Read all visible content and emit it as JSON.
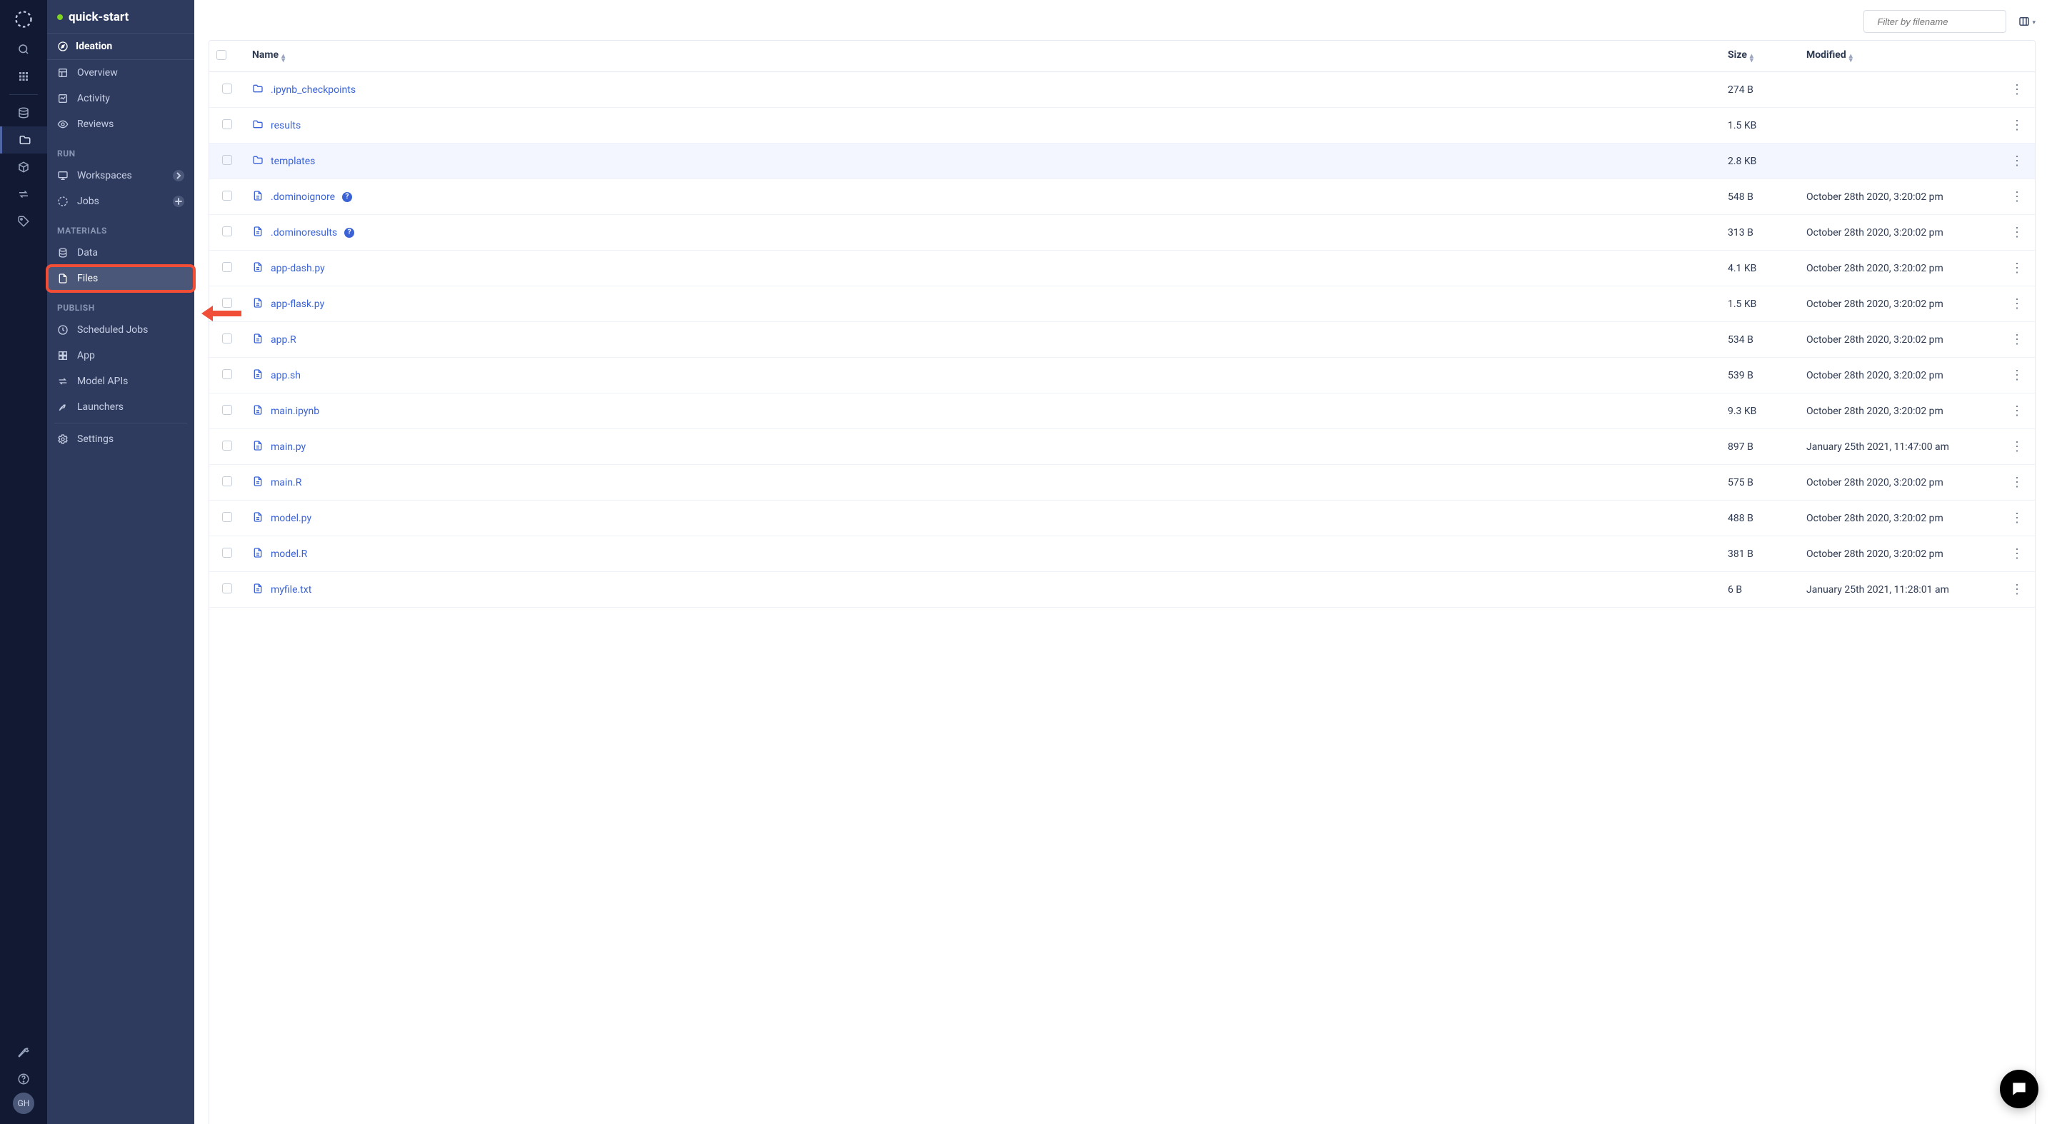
{
  "project": {
    "name": "quick-start"
  },
  "sidebar": {
    "section": "Ideation",
    "groups": {
      "ideation": [
        "Overview",
        "Activity",
        "Reviews"
      ],
      "run_label": "RUN",
      "run": [
        "Workspaces",
        "Jobs"
      ],
      "materials_label": "MATERIALS",
      "materials": [
        "Data",
        "Files"
      ],
      "publish_label": "PUBLISH",
      "publish": [
        "Scheduled Jobs",
        "App",
        "Model APIs",
        "Launchers"
      ]
    },
    "settings": "Settings"
  },
  "rail": {
    "avatar": "GH"
  },
  "topbar": {
    "search_placeholder": "Filter by filename"
  },
  "table": {
    "headers": {
      "name": "Name",
      "size": "Size",
      "modified": "Modified"
    },
    "rows": [
      {
        "type": "folder",
        "name": ".ipynb_checkpoints",
        "size": "274 B",
        "modified": "",
        "help": false
      },
      {
        "type": "folder",
        "name": "results",
        "size": "1.5 KB",
        "modified": "",
        "help": false
      },
      {
        "type": "folder",
        "name": "templates",
        "size": "2.8 KB",
        "modified": "",
        "help": false,
        "highlight": true
      },
      {
        "type": "file",
        "name": ".dominoignore",
        "size": "548 B",
        "modified": "October 28th 2020, 3:20:02 pm",
        "help": true
      },
      {
        "type": "file",
        "name": ".dominoresults",
        "size": "313 B",
        "modified": "October 28th 2020, 3:20:02 pm",
        "help": true
      },
      {
        "type": "file",
        "name": "app-dash.py",
        "size": "4.1 KB",
        "modified": "October 28th 2020, 3:20:02 pm",
        "help": false
      },
      {
        "type": "file",
        "name": "app-flask.py",
        "size": "1.5 KB",
        "modified": "October 28th 2020, 3:20:02 pm",
        "help": false
      },
      {
        "type": "file",
        "name": "app.R",
        "size": "534 B",
        "modified": "October 28th 2020, 3:20:02 pm",
        "help": false
      },
      {
        "type": "file",
        "name": "app.sh",
        "size": "539 B",
        "modified": "October 28th 2020, 3:20:02 pm",
        "help": false
      },
      {
        "type": "file",
        "name": "main.ipynb",
        "size": "9.3 KB",
        "modified": "October 28th 2020, 3:20:02 pm",
        "help": false
      },
      {
        "type": "file",
        "name": "main.py",
        "size": "897 B",
        "modified": "January 25th 2021, 11:47:00 am",
        "help": false
      },
      {
        "type": "file",
        "name": "main.R",
        "size": "575 B",
        "modified": "October 28th 2020, 3:20:02 pm",
        "help": false
      },
      {
        "type": "file",
        "name": "model.py",
        "size": "488 B",
        "modified": "October 28th 2020, 3:20:02 pm",
        "help": false
      },
      {
        "type": "file",
        "name": "model.R",
        "size": "381 B",
        "modified": "October 28th 2020, 3:20:02 pm",
        "help": false
      },
      {
        "type": "file",
        "name": "myfile.txt",
        "size": "6 B",
        "modified": "January 25th 2021, 11:28:01 am",
        "help": false
      }
    ]
  }
}
